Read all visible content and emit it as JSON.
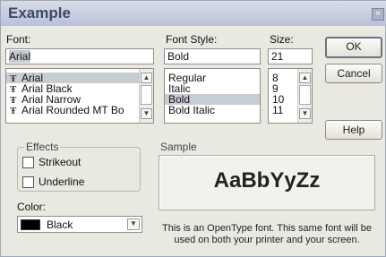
{
  "window": {
    "title": "Example",
    "close_glyph": "×"
  },
  "font": {
    "label": "Font:",
    "value": "Arial",
    "list": [
      "Arial",
      "Arial Black",
      "Arial Narrow",
      "Arial Rounded MT Bo"
    ],
    "selected_index": 0,
    "item_icon": "truetype-icon"
  },
  "style": {
    "label": "Font Style:",
    "value": "Bold",
    "list": [
      "Regular",
      "Italic",
      "Bold",
      "Bold Italic"
    ],
    "selected_index": 2
  },
  "size": {
    "label": "Size:",
    "value": "21",
    "list": [
      "8",
      "9",
      "10",
      "11"
    ]
  },
  "buttons": {
    "ok": "OK",
    "cancel": "Cancel",
    "help": "Help"
  },
  "effects": {
    "title": "Effects",
    "strikeout": "Strikeout",
    "underline": "Underline",
    "strikeout_checked": false,
    "underline_checked": false
  },
  "color": {
    "label": "Color:",
    "value": "Black",
    "swatch": "#000000"
  },
  "sample": {
    "title": "Sample",
    "text": "AaBbYyZz",
    "note_line1": "This is an OpenType font. This same font will be",
    "note_line2": "used on both your printer and your screen."
  }
}
